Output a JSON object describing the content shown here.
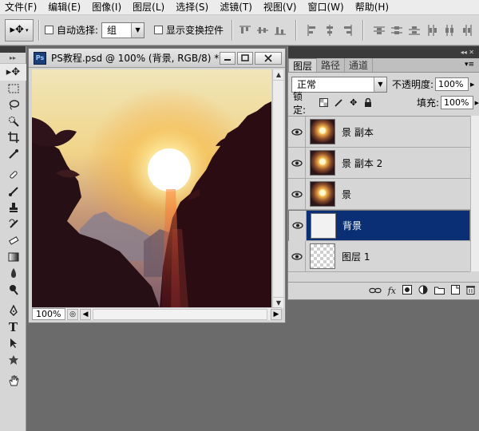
{
  "menu": [
    "文件(F)",
    "编辑(E)",
    "图像(I)",
    "图层(L)",
    "选择(S)",
    "滤镜(T)",
    "视图(V)",
    "窗口(W)",
    "帮助(H)"
  ],
  "options": {
    "auto_select_label": "自动选择:",
    "auto_select_value": "组",
    "show_transform_label": "显示变换控件"
  },
  "document": {
    "title": "PS教程.psd @ 100% (背景, RGB/8) *",
    "ps_badge": "Ps",
    "zoom": "100%"
  },
  "layers_panel": {
    "tabs": [
      "图层",
      "路径",
      "通道"
    ],
    "blend_mode": "正常",
    "opacity_label": "不透明度:",
    "opacity_value": "100%",
    "lock_label": "锁定:",
    "fill_label": "填充:",
    "fill_value": "100%",
    "layers": [
      {
        "name": "景 副本",
        "thumb": "sun",
        "selected": false
      },
      {
        "name": "景 副本 2",
        "thumb": "sun",
        "selected": false
      },
      {
        "name": "景",
        "thumb": "sun",
        "selected": false
      },
      {
        "name": "背景",
        "thumb": "white",
        "selected": true
      },
      {
        "name": "图层 1",
        "thumb": "checker",
        "selected": false
      }
    ]
  },
  "colors": {
    "selection": "#0a2f74",
    "workspace": "#6b6b6b"
  }
}
